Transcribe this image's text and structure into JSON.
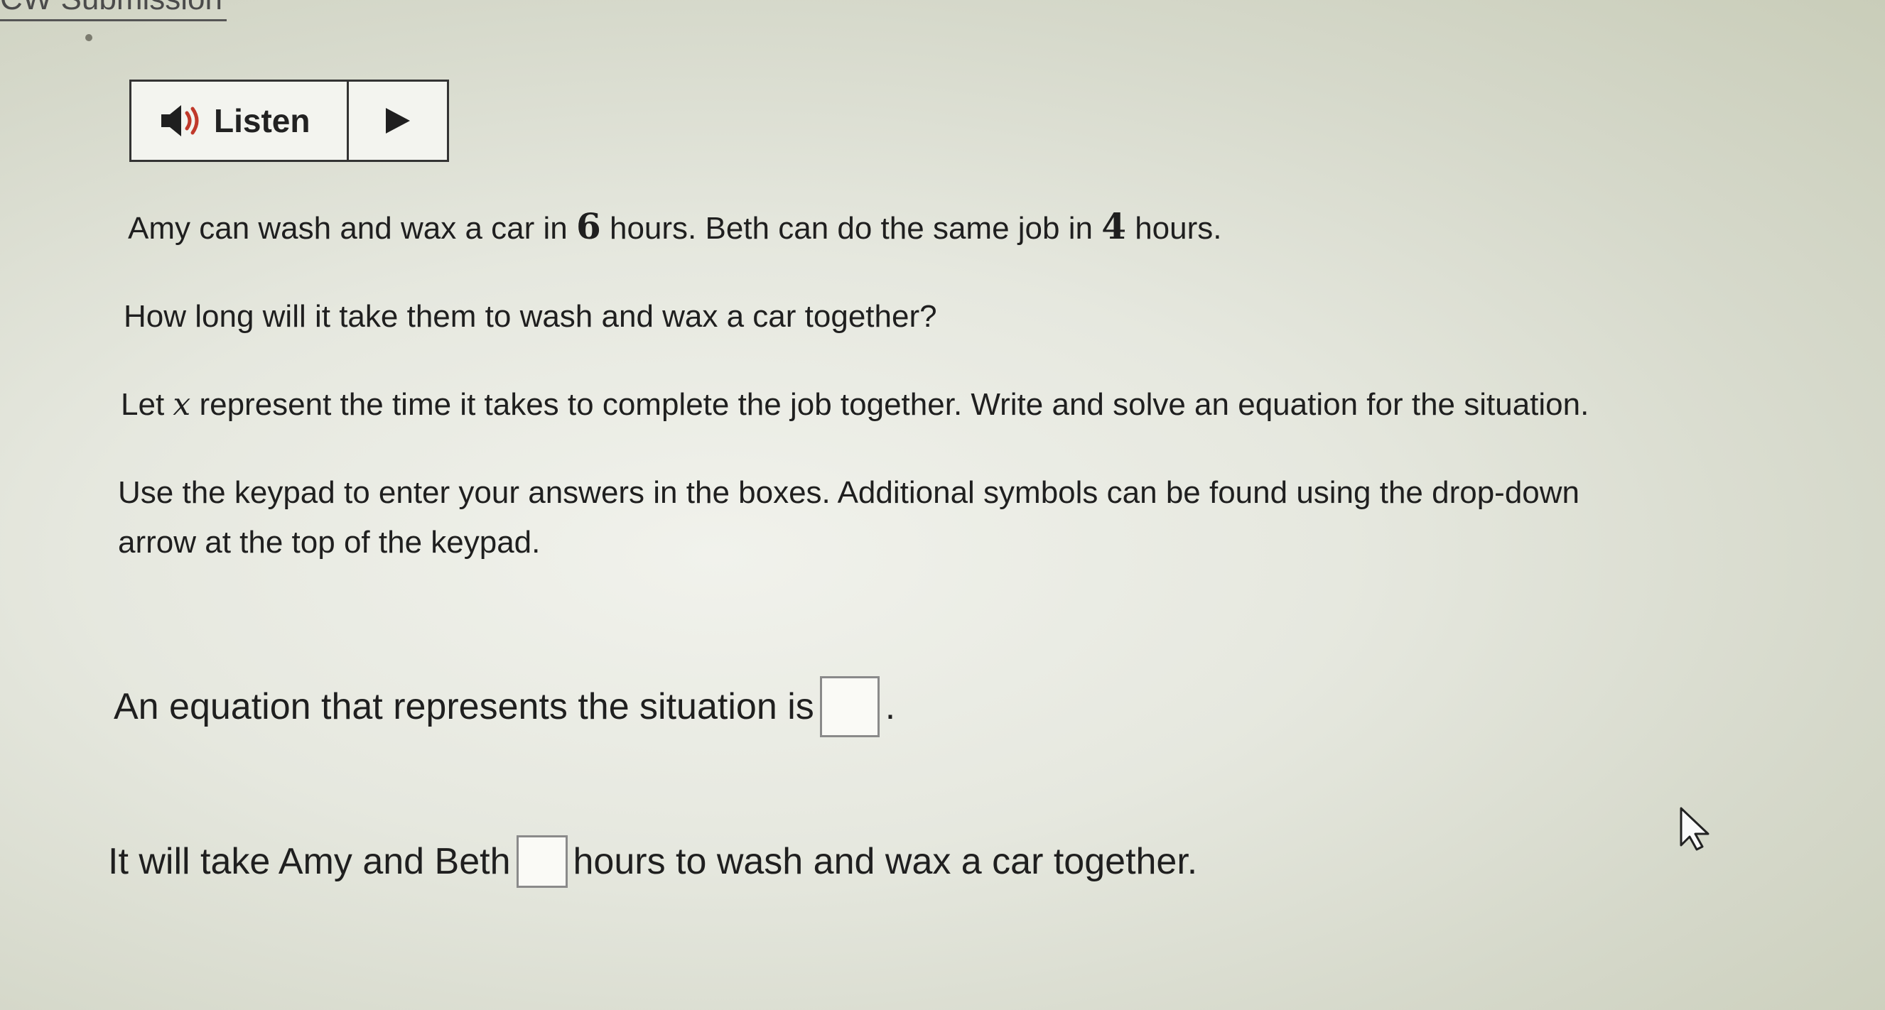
{
  "header": {
    "title": "CW Submission"
  },
  "listen": {
    "label": "Listen"
  },
  "problem": {
    "line1_part1": "Amy can wash and wax a car in ",
    "amy_hours": "6",
    "line1_part2": " hours. Beth can do the same job in ",
    "beth_hours": "4",
    "line1_part3": " hours.",
    "line2": "How long will it take them to wash and wax a car together?",
    "line3_part1": "Let ",
    "variable": "x",
    "line3_part2": " represent the time it takes to complete the job together. Write and solve an equation for the situation.",
    "line4": "Use the keypad to enter your answers in the boxes. Additional symbols can be found using the drop-down",
    "line5": "arrow at the top of the keypad."
  },
  "answers": {
    "equation_prefix": "An equation that represents the situation is",
    "equation_suffix": ".",
    "time_prefix": "It will take Amy and Beth",
    "time_suffix": "hours to wash and wax a car together."
  },
  "icons": [
    "speaker-icon",
    "play-icon",
    "mouse-cursor-icon"
  ]
}
